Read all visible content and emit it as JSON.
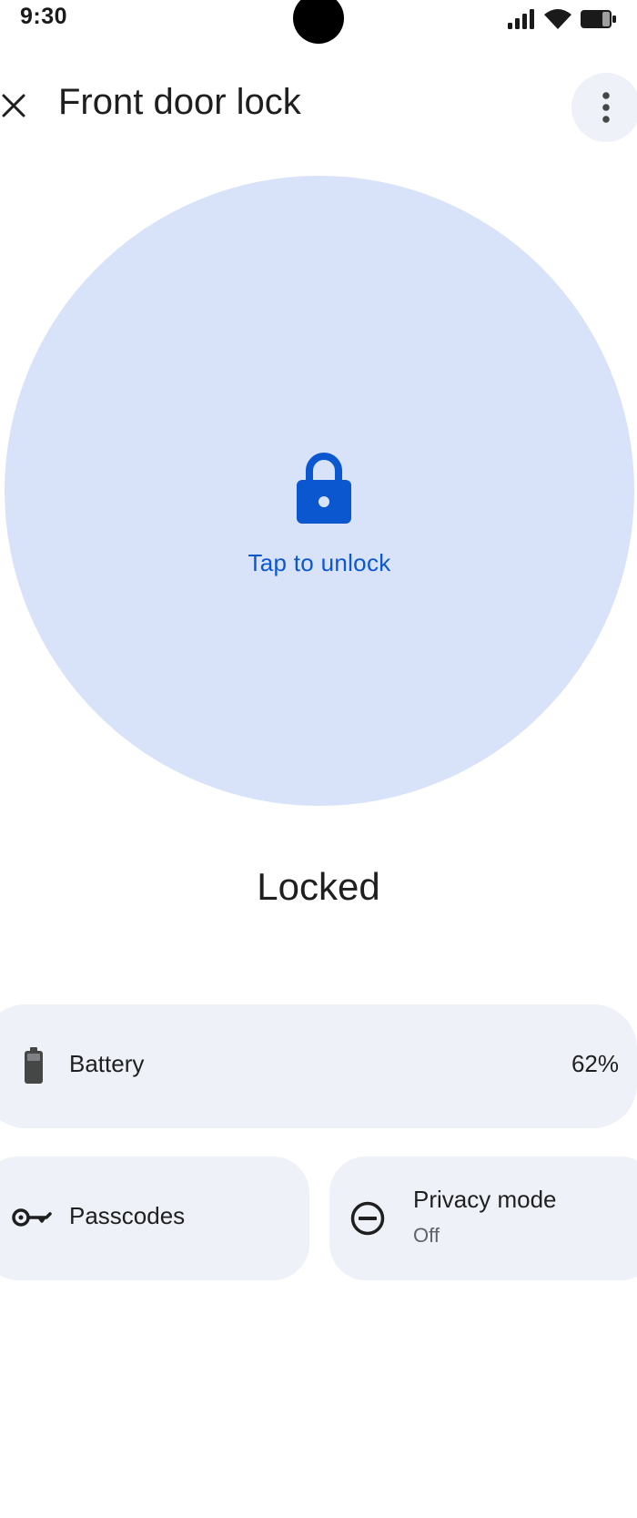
{
  "status_bar": {
    "time": "9:30"
  },
  "app_bar": {
    "title": "Front door lock",
    "close_icon": "close-icon",
    "more_icon": "more-vert-icon"
  },
  "lock_control": {
    "icon": "lock-icon",
    "action_label": "Tap to unlock",
    "status": "Locked",
    "accent_color": "#0b57d0",
    "circle_color": "#d8e3fa"
  },
  "cards": {
    "battery": {
      "icon": "battery-icon",
      "label": "Battery",
      "value": "62%"
    },
    "passcodes": {
      "icon": "key-icon",
      "label": "Passcodes"
    },
    "privacy": {
      "icon": "do-not-disturb-icon",
      "label": "Privacy mode",
      "value": "Off"
    }
  }
}
